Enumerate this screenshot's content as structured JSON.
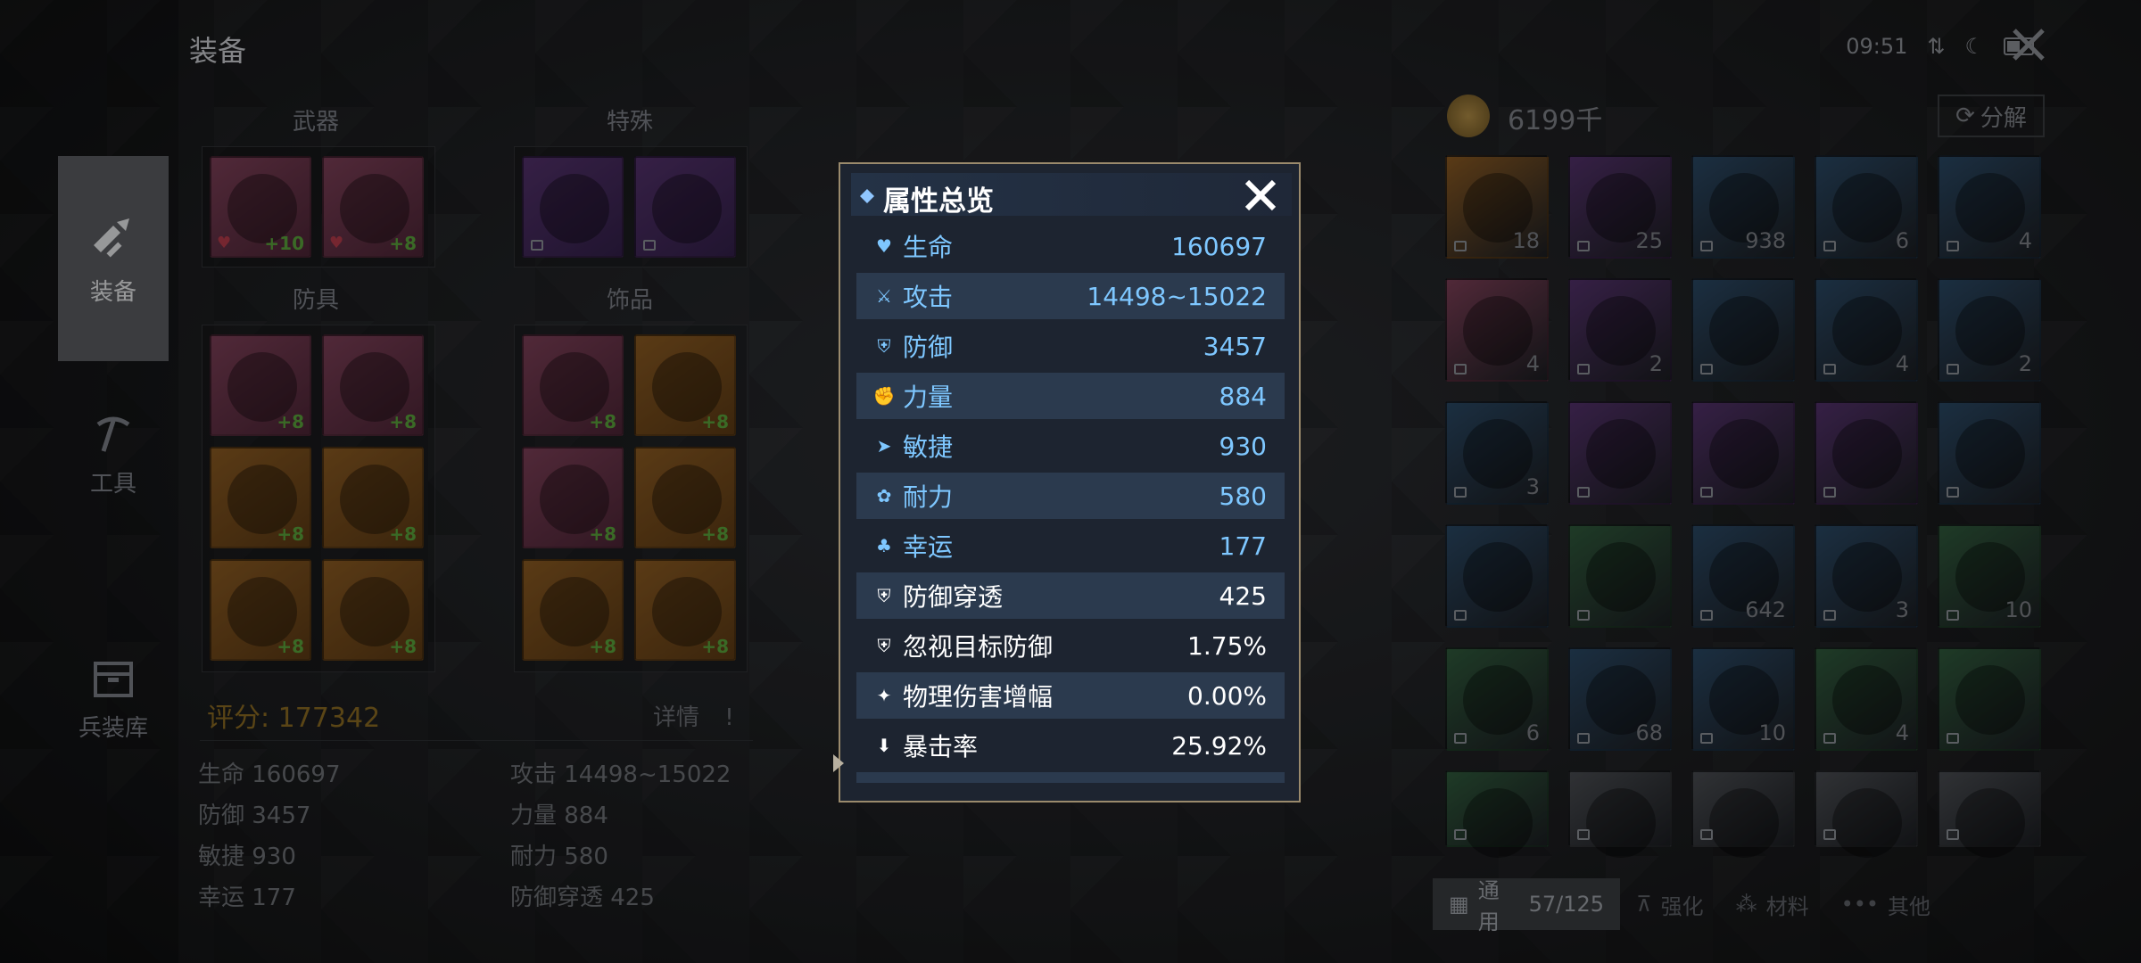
{
  "header": {
    "title": "装备"
  },
  "status_bar": {
    "time": "09:51"
  },
  "nav": {
    "items": [
      {
        "label": "装备",
        "active": true
      },
      {
        "label": "工具",
        "active": false
      },
      {
        "label": "兵装库",
        "active": false
      }
    ]
  },
  "equipment": {
    "weapons_label": "武器",
    "special_label": "特殊",
    "armor_label": "防具",
    "accessory_label": "饰品",
    "weapon_slots": [
      {
        "plus": "+10"
      },
      {
        "plus": "+8"
      }
    ],
    "special_slots": [
      {
        "plus": ""
      },
      {
        "plus": ""
      }
    ],
    "armor_slots": [
      {
        "plus": "+8"
      },
      {
        "plus": "+8"
      },
      {
        "plus": "+8"
      },
      {
        "plus": "+8"
      },
      {
        "plus": "+8"
      },
      {
        "plus": "+8"
      }
    ],
    "accessory_slots": [
      {
        "plus": "+8"
      },
      {
        "plus": "+8"
      },
      {
        "plus": "+8"
      },
      {
        "plus": "+8"
      },
      {
        "plus": "+8"
      },
      {
        "plus": "+8"
      }
    ],
    "score_label": "评分:",
    "score_value": "177342",
    "detail_label": "详情",
    "stats": [
      {
        "label": "生命 160697"
      },
      {
        "label": "攻击 14498~15022"
      },
      {
        "label": "防御 3457"
      },
      {
        "label": "力量 884"
      },
      {
        "label": "敏捷 930"
      },
      {
        "label": "耐力 580"
      },
      {
        "label": "幸运 177"
      },
      {
        "label": "防御穿透 425"
      }
    ]
  },
  "inventory": {
    "currency": "6199千",
    "decompose_label": "分解",
    "items": [
      {
        "count": "18",
        "quality": "#8a5a22"
      },
      {
        "count": "25",
        "quality": "#53316b"
      },
      {
        "count": "938",
        "quality": "#2a4864"
      },
      {
        "count": "6",
        "quality": "#2a4864"
      },
      {
        "count": "4",
        "quality": "#2a4864"
      },
      {
        "count": "4",
        "quality": "#7c3f57"
      },
      {
        "count": "2",
        "quality": "#53316b"
      },
      {
        "count": "",
        "quality": "#2a4864"
      },
      {
        "count": "4",
        "quality": "#2a4864"
      },
      {
        "count": "2",
        "quality": "#2a4864"
      },
      {
        "count": "3",
        "quality": "#2a4864"
      },
      {
        "count": "",
        "quality": "#53316b"
      },
      {
        "count": "",
        "quality": "#53316b"
      },
      {
        "count": "",
        "quality": "#53316b"
      },
      {
        "count": "",
        "quality": "#2a4864"
      },
      {
        "count": "",
        "quality": "#2a4864"
      },
      {
        "count": "",
        "quality": "#2f5a3c"
      },
      {
        "count": "642",
        "quality": "#2a4864"
      },
      {
        "count": "3",
        "quality": "#2a4864"
      },
      {
        "count": "10",
        "quality": "#2f5a3c"
      },
      {
        "count": "6",
        "quality": "#2f5a3c"
      },
      {
        "count": "68",
        "quality": "#2a4864"
      },
      {
        "count": "10",
        "quality": "#2a4864"
      },
      {
        "count": "4",
        "quality": "#2f5a3c"
      },
      {
        "count": "",
        "quality": "#2f5a3c"
      },
      {
        "count": "",
        "quality": "#2f5a3c"
      },
      {
        "count": "",
        "quality": "#4a4d52"
      },
      {
        "count": "",
        "quality": "#4a4d52"
      },
      {
        "count": "",
        "quality": "#4a4d52"
      },
      {
        "count": "",
        "quality": "#4a4d52"
      }
    ],
    "tabs": [
      {
        "label": "通用",
        "count": "57/125",
        "active": true
      },
      {
        "label": "强化",
        "count": "",
        "active": false
      },
      {
        "label": "材料",
        "count": "",
        "active": false
      },
      {
        "label": "其他",
        "count": "",
        "active": false
      }
    ]
  },
  "dialog": {
    "title": "属性总览",
    "rows": [
      {
        "name": "生命",
        "value": "160697",
        "icon": "heart-icon",
        "color": "blue"
      },
      {
        "name": "攻击",
        "value": "14498~15022",
        "icon": "sword-icon",
        "color": "blue"
      },
      {
        "name": "防御",
        "value": "3457",
        "icon": "shield-icon",
        "color": "blue"
      },
      {
        "name": "力量",
        "value": "884",
        "icon": "muscle-icon",
        "color": "blue"
      },
      {
        "name": "敏捷",
        "value": "930",
        "icon": "boot-icon",
        "color": "blue"
      },
      {
        "name": "耐力",
        "value": "580",
        "icon": "paw-icon",
        "color": "blue"
      },
      {
        "name": "幸运",
        "value": "177",
        "icon": "clover-icon",
        "color": "blue"
      },
      {
        "name": "防御穿透",
        "value": "425",
        "icon": "shield-break-icon",
        "color": "white"
      },
      {
        "name": "忽视目标防御",
        "value": "1.75%",
        "icon": "shield-ignore-icon",
        "color": "white"
      },
      {
        "name": "物理伤害增幅",
        "value": "0.00%",
        "icon": "damage-boost-icon",
        "color": "white"
      },
      {
        "name": "暴击率",
        "value": "25.92%",
        "icon": "crit-icon",
        "color": "white"
      }
    ]
  }
}
